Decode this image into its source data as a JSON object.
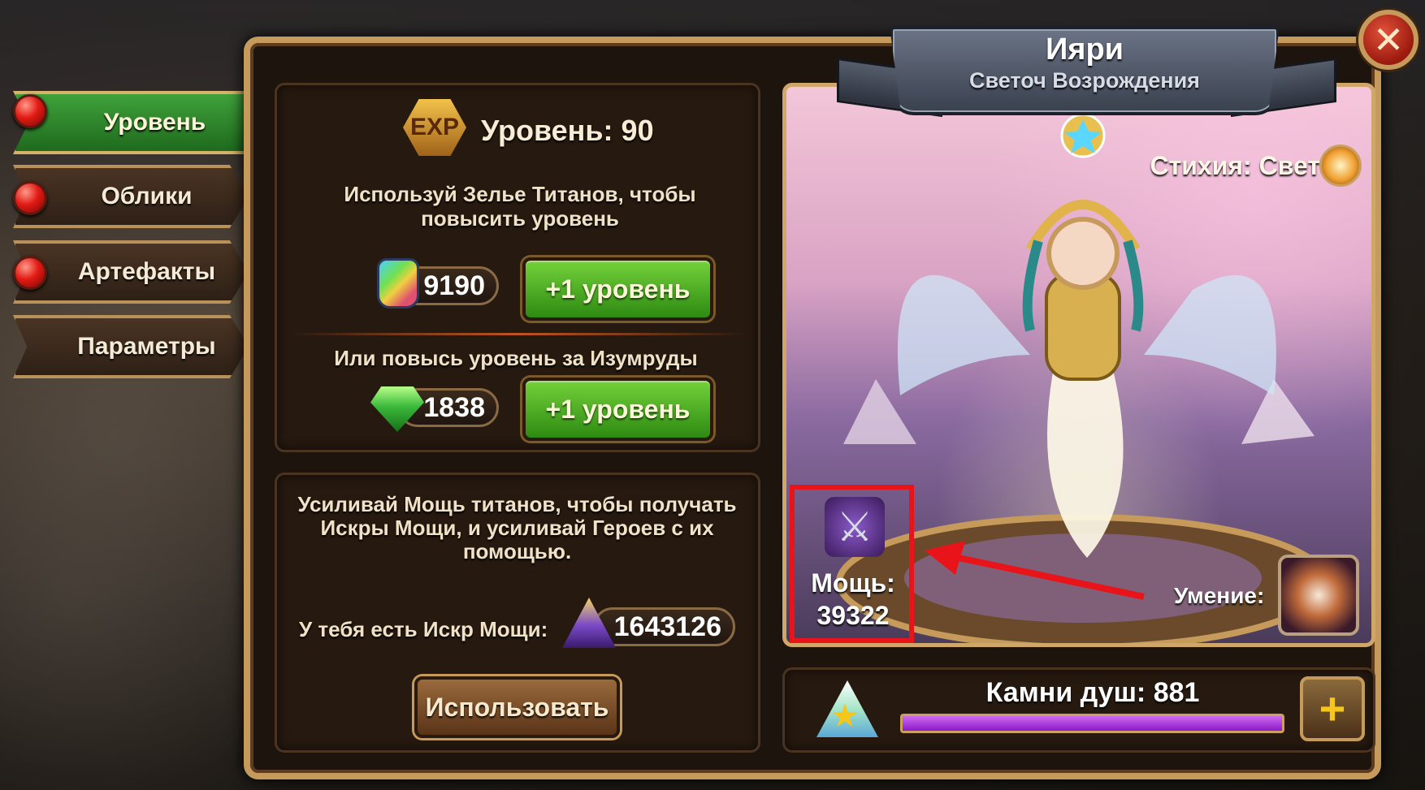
{
  "tabs": [
    {
      "label": "Уровень",
      "active": true,
      "has_notification": true
    },
    {
      "label": "Облики",
      "active": false,
      "has_notification": true
    },
    {
      "label": "Артефакты",
      "active": false,
      "has_notification": true
    },
    {
      "label": "Параметры",
      "active": false,
      "has_notification": false
    }
  ],
  "level_panel": {
    "exp_badge": "EXP",
    "level_text": "Уровень: 90",
    "potion_hint": "Используй Зелье Титанов, чтобы повысить уровень",
    "potion_count": "9190",
    "potion_button": "+1 уровень",
    "emerald_hint": "Или повысь уровень за Изумруды",
    "emerald_count": "1838",
    "emerald_button": "+1 уровень"
  },
  "sparks_panel": {
    "description": "Усиливай Мощь титанов, чтобы получать Искры Мощи, и усиливай Героев с их помощью.",
    "owned_label": "У тебя есть Искр Мощи:",
    "owned_count": "1643126",
    "use_button": "Использовать"
  },
  "hero": {
    "name": "Ияри",
    "title": "Светоч Возрождения",
    "element_text": "Стихия: Свет",
    "power_label": "Мощь:",
    "power_value": "39322",
    "skill_label": "Умение:"
  },
  "soul_stones": {
    "label": "Камни душ: 881",
    "progress": 1.0
  },
  "colors": {
    "accent_gold": "#c59a5b",
    "button_green": "#3fa23a",
    "annotation_red": "#e8141a",
    "progress_purple": "#a93ad8"
  }
}
